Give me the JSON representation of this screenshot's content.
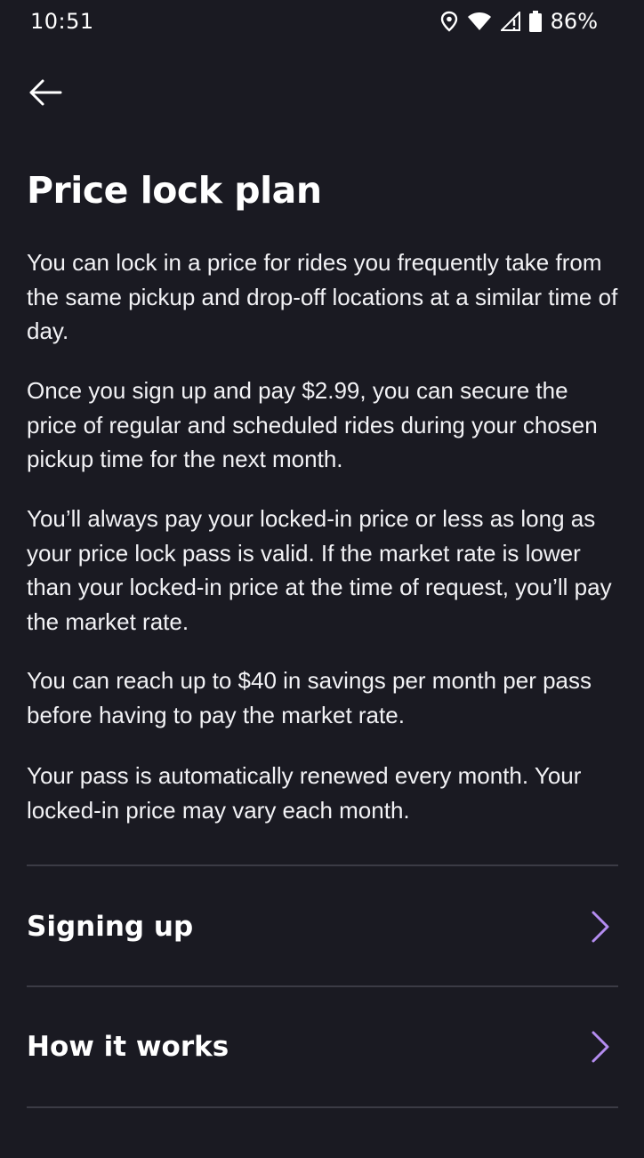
{
  "status_bar": {
    "time": "10:51",
    "battery": "86%",
    "icons": [
      "location-icon",
      "wifi-icon",
      "signal-icon",
      "battery-icon"
    ]
  },
  "header": {
    "back_icon": "arrow-left-icon"
  },
  "content": {
    "title": "Price lock plan",
    "paragraphs": [
      "You can lock in a price for rides you frequently take from the same pickup and drop-off locations at a similar time of day.",
      "Once you sign up and pay $2.99, you can secure the price of regular and scheduled rides during your chosen pickup time for the next month.",
      "You’ll always pay your locked-in price or less as long as your price lock pass is valid. If the market rate is lower than your locked-in price at the time of request, you’ll pay the market rate.",
      "You can reach up to $40 in savings per month per pass before having to pay the market rate.",
      "Your pass is automatically renewed every month. Your locked-in price may vary each month."
    ]
  },
  "sections": [
    {
      "label": "Signing up",
      "icon": "chevron-right-icon"
    },
    {
      "label": "How it works",
      "icon": "chevron-right-icon"
    }
  ],
  "colors": {
    "background": "#1a1a22",
    "text": "#ffffff",
    "accent": "#b48cf0",
    "divider": "#3b3b45"
  }
}
